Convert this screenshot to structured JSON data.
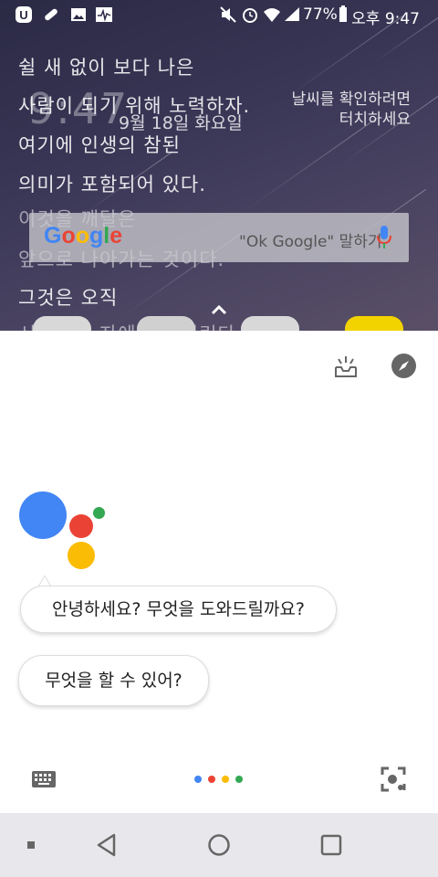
{
  "status_bar": {
    "battery": "77%",
    "time": "오후 9:47"
  },
  "home": {
    "poem_lines": [
      "쉴 새 없이 보다 나은",
      "사람이 되기 위해 노력하자.",
      "여기에 인생의 참된",
      "의미가 포함되어 있다.",
      "이것을 깨달은",
      "앞으로 나아가는 것이다.",
      "그것은 오직",
      "시도하는 자에게만 열린다"
    ],
    "clock": "9:47",
    "date": "9월 18일 화요일",
    "weather_line1": "날씨를 확인하려면",
    "weather_line2": "터치하세요",
    "search": {
      "logo": "Google",
      "hint": "\"Ok Google\" 말하기"
    }
  },
  "assistant": {
    "greeting": "안녕하세요? 무엇을 도와드릴까요?",
    "suggestion": "무엇을 할 수 있어?",
    "colors": {
      "blue": "#4285F4",
      "red": "#EA4335",
      "yellow": "#FBBC05",
      "green": "#34A853"
    }
  },
  "icons": {
    "status": [
      "u-plus-icon",
      "pill-icon",
      "image-icon",
      "activity-icon",
      "mute-icon",
      "alarm-icon",
      "wifi-icon",
      "signal-icon",
      "battery-icon"
    ],
    "assistant": [
      "inbox-icon",
      "explore-icon",
      "keyboard-icon",
      "lens-icon"
    ],
    "nav": [
      "home-square-icon",
      "back-icon",
      "home-icon",
      "recents-icon"
    ]
  }
}
